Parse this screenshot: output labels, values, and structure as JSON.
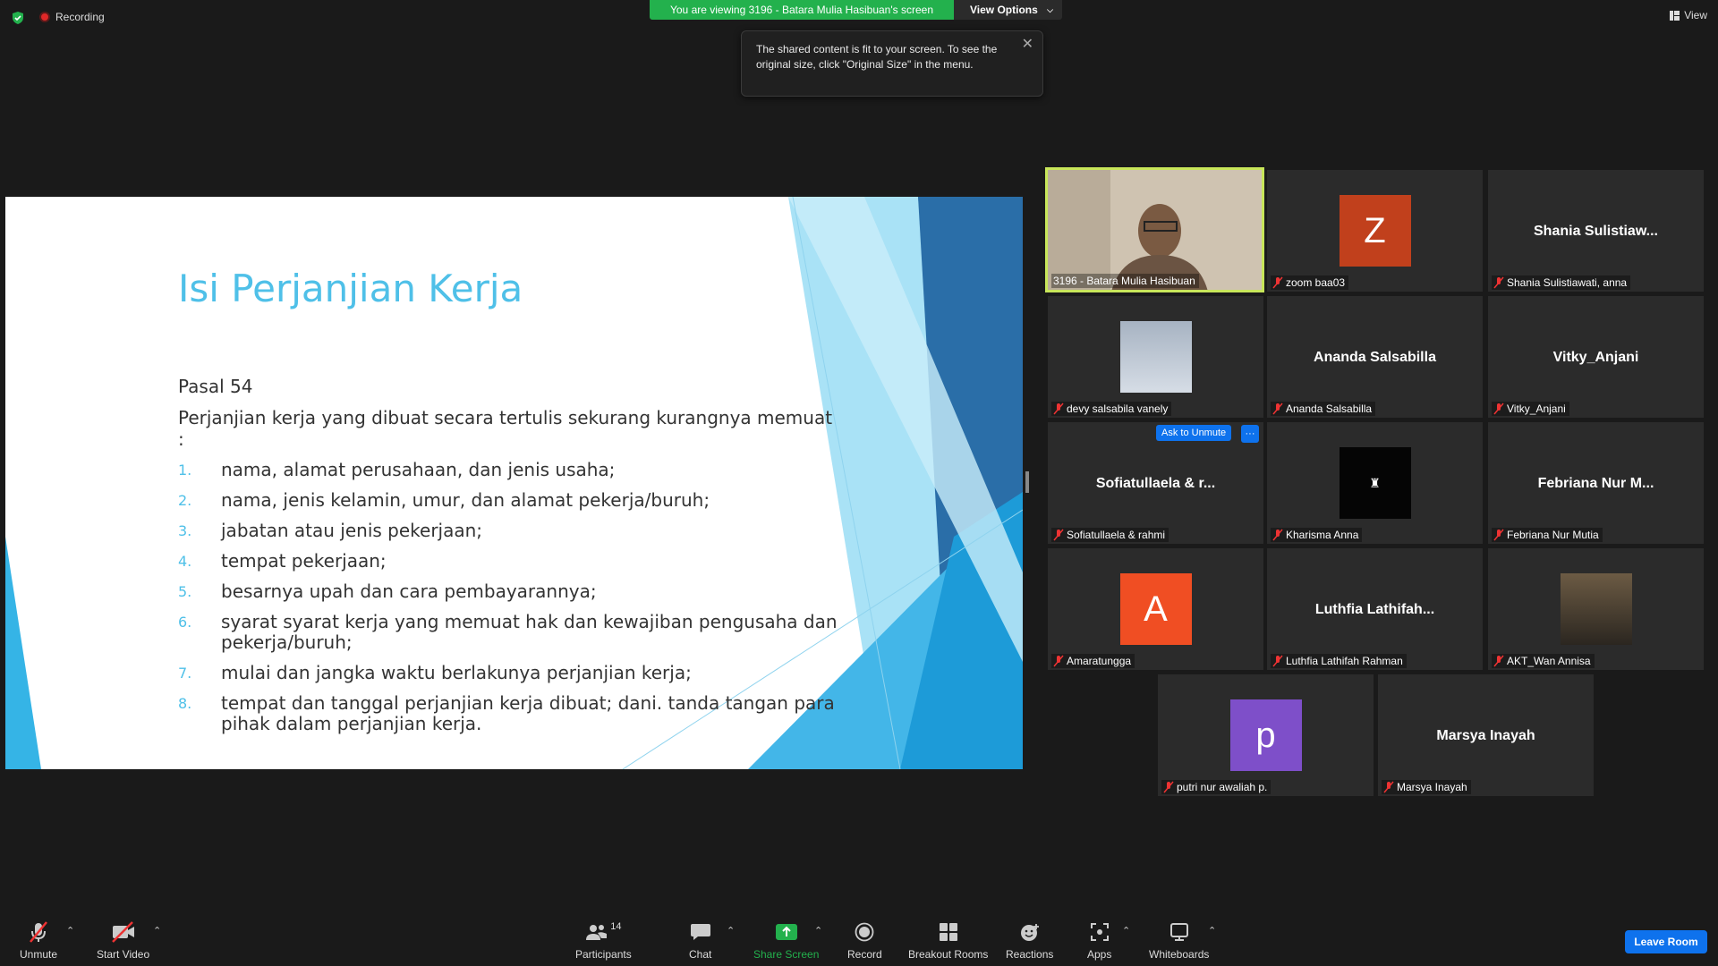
{
  "top": {
    "recording": "Recording",
    "banner": "You are viewing 3196 - Batara Mulia Hasibuan's screen",
    "view_options": "View Options",
    "view": "View",
    "tooltip": "The shared content is fit to your screen. To see the original size, click \"Original Size\" in the menu."
  },
  "slide": {
    "title": "Isi Perjanjian Kerja",
    "pasal": "Pasal 54",
    "intro": "Perjanjian kerja yang dibuat secara tertulis sekurang kurangnya memuat :",
    "items": [
      {
        "num": "1.",
        "text": "nama, alamat perusahaan, dan jenis usaha;"
      },
      {
        "num": "2.",
        "text": "nama, jenis kelamin, umur, dan alamat pekerja/buruh;"
      },
      {
        "num": "3.",
        "text": "jabatan atau jenis pekerjaan;"
      },
      {
        "num": "4.",
        "text": "tempat pekerjaan;"
      },
      {
        "num": "5.",
        "text": "besarnya upah dan cara pembayarannya;"
      },
      {
        "num": "6.",
        "text": "syarat syarat kerja yang memuat hak dan kewajiban pengusaha dan pekerja/buruh;"
      },
      {
        "num": "7.",
        "text": "mulai dan jangka waktu berlakunya perjanjian kerja;"
      },
      {
        "num": "8.",
        "text": "tempat dan tanggal perjanjian kerja dibuat; dani. tanda tangan para pihak dalam perjanjian kerja."
      }
    ]
  },
  "gallery": {
    "ask_to_unmute": "Ask to Unmute",
    "more": "···",
    "tiles": [
      {
        "label": "3196 - Batara Mulia Hasibuan",
        "display": "",
        "avatar": "",
        "muted": false
      },
      {
        "label": "zoom baa03",
        "display": "",
        "avatar": "Z",
        "avatar_color": "#c1401c",
        "muted": true
      },
      {
        "label": "Shania Sulistiawati, anna",
        "display": "Shania  Sulistiaw...",
        "avatar": "",
        "muted": true
      },
      {
        "label": "devy salsabila vanely",
        "display": "",
        "avatar": "",
        "muted": true
      },
      {
        "label": "Ananda Salsabilla",
        "display": "Ananda Salsabilla",
        "avatar": "",
        "muted": true
      },
      {
        "label": "Vitky_Anjani",
        "display": "Vitky_Anjani",
        "avatar": "",
        "muted": true
      },
      {
        "label": "Sofiatullaela & rahmi",
        "display": "Sofiatullaela & r...",
        "avatar": "",
        "muted": true
      },
      {
        "label": "Kharisma Anna",
        "display": "",
        "avatar": "",
        "muted": true
      },
      {
        "label": "Febriana Nur Mutia",
        "display": "Febriana Nur M...",
        "avatar": "",
        "muted": true
      },
      {
        "label": "Amaratungga",
        "display": "",
        "avatar": "A",
        "avatar_color": "#f04e23",
        "muted": true
      },
      {
        "label": "Luthfia Lathifah Rahman",
        "display": "Luthfia  Lathifah...",
        "avatar": "",
        "muted": true
      },
      {
        "label": "AKT_Wan Annisa",
        "display": "",
        "avatar": "",
        "muted": true
      },
      {
        "label": "putri nur awaliah p.",
        "display": "",
        "avatar": "p",
        "avatar_color": "#7e4fc9",
        "muted": true
      },
      {
        "label": "Marsya Inayah",
        "display": "Marsya Inayah",
        "avatar": "",
        "muted": true
      }
    ]
  },
  "toolbar": {
    "unmute": "Unmute",
    "start_video": "Start Video",
    "participants": "Participants",
    "participants_count": "14",
    "chat": "Chat",
    "share_screen": "Share Screen",
    "record": "Record",
    "breakout_rooms": "Breakout Rooms",
    "reactions": "Reactions",
    "apps": "Apps",
    "whiteboards": "Whiteboards",
    "leave": "Leave Room"
  },
  "colors": {
    "accent_green": "#23b14d",
    "accent_blue": "#0e72ed",
    "slide_title": "#4fc0e8",
    "active_border": "#c8e65a"
  }
}
